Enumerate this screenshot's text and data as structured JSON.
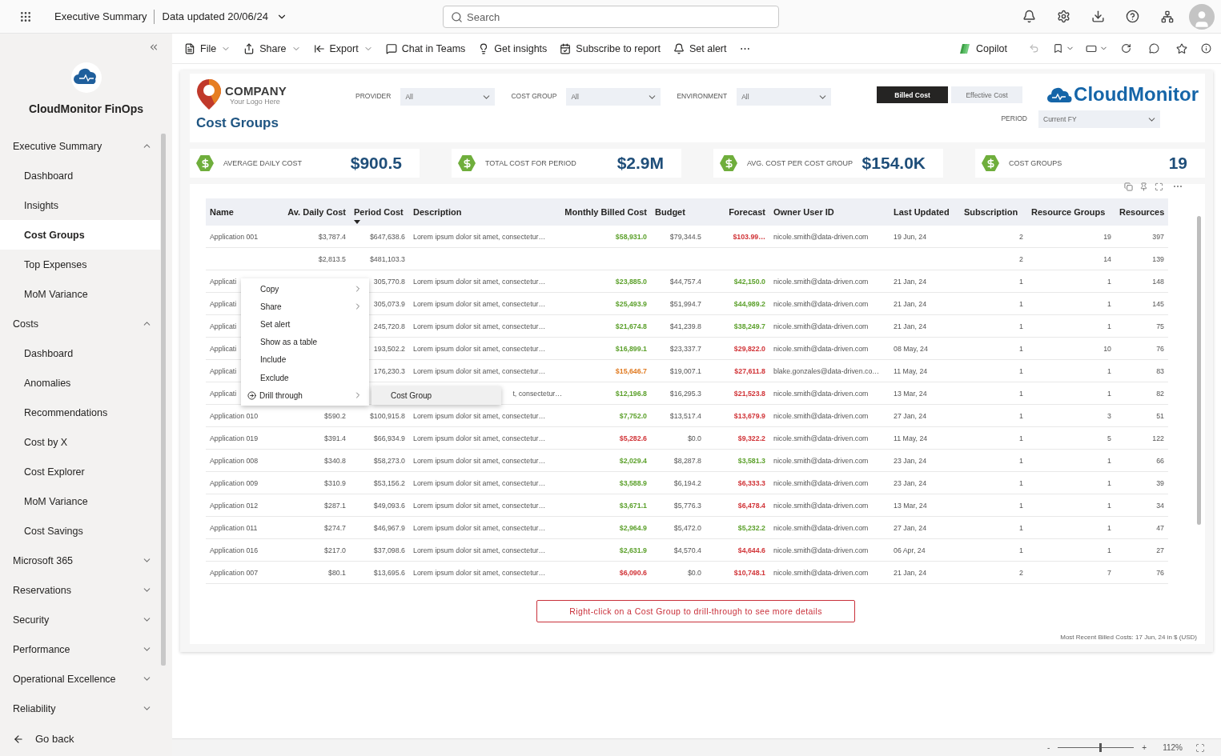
{
  "top_bar": {
    "report": "Executive Summary",
    "updated": "Data updated 20/06/24",
    "search": {
      "placeholder": "Search"
    }
  },
  "sidebar": {
    "app_name": "CloudMonitor FinOps",
    "nav": [
      {
        "label": "Executive Summary",
        "expanded": true,
        "children": [
          {
            "label": "Dashboard",
            "selected": false
          },
          {
            "label": "Insights",
            "selected": false
          },
          {
            "label": "Cost Groups",
            "selected": true
          },
          {
            "label": "Top Expenses",
            "selected": false
          },
          {
            "label": "MoM Variance",
            "selected": false
          }
        ]
      },
      {
        "label": "Costs",
        "expanded": true,
        "children": [
          {
            "label": "Dashboard",
            "selected": false
          },
          {
            "label": "Anomalies",
            "selected": false
          },
          {
            "label": "Recommendations",
            "selected": false
          },
          {
            "label": "Cost by X",
            "selected": false
          },
          {
            "label": "Cost Explorer",
            "selected": false
          },
          {
            "label": "MoM Variance",
            "selected": false
          },
          {
            "label": "Cost Savings",
            "selected": false
          }
        ]
      },
      {
        "label": "Microsoft 365",
        "expanded": false
      },
      {
        "label": "Reservations",
        "expanded": false
      },
      {
        "label": "Security",
        "expanded": false
      },
      {
        "label": "Performance",
        "expanded": false
      },
      {
        "label": "Operational Excellence",
        "expanded": false
      },
      {
        "label": "Reliability",
        "expanded": false
      }
    ],
    "back": "Go back"
  },
  "toolbar": {
    "actions": [
      {
        "label": "File",
        "caret": true
      },
      {
        "label": "Share",
        "caret": true
      },
      {
        "label": "Export",
        "caret": true
      },
      {
        "label": "Chat in Teams",
        "caret": false
      },
      {
        "label": "Get insights",
        "caret": false
      },
      {
        "label": "Subscribe to report",
        "caret": false
      },
      {
        "label": "Set alert",
        "caret": false
      }
    ],
    "more": "⋯",
    "copilot": "Copilot"
  },
  "report": {
    "company": "COMPANY",
    "tagline": "Your Logo Here",
    "title": "Cost Groups",
    "brand": "CloudMonitor",
    "filters": [
      {
        "label": "PROVIDER",
        "value": "All"
      },
      {
        "label": "COST GROUP",
        "value": "All"
      },
      {
        "label": "ENVIRONMENT",
        "value": "All"
      }
    ],
    "cost_toggle": [
      {
        "label": "Billed Cost",
        "selected": true
      },
      {
        "label": "Effective Cost",
        "selected": false
      }
    ],
    "period": {
      "label": "PERIOD",
      "value": "Current FY"
    },
    "kpis": [
      {
        "label": "AVERAGE DAILY COST",
        "value": "$900.5"
      },
      {
        "label": "TOTAL COST FOR PERIOD",
        "value": "$2.9M"
      },
      {
        "label": "AVG. COST PER COST GROUP",
        "value": "$154.0K"
      },
      {
        "label": "COST GROUPS",
        "value": "19"
      }
    ],
    "table": {
      "more": "⋯",
      "columns": [
        {
          "label": "Name",
          "sorted": false
        },
        {
          "label": "Av. Daily Cost",
          "sorted": false
        },
        {
          "label": "Period Cost",
          "sorted": true
        },
        {
          "label": "Description",
          "sorted": false
        },
        {
          "label": "Monthly Billed Cost",
          "sorted": false
        },
        {
          "label": "Budget",
          "sorted": false
        },
        {
          "label": "Forecast",
          "sorted": false
        },
        {
          "label": "Owner User ID",
          "sorted": false
        },
        {
          "label": "Last Updated",
          "sorted": false
        },
        {
          "label": "Subscription",
          "sorted": false
        },
        {
          "label": "Resource Groups",
          "sorted": false
        },
        {
          "label": "Resources",
          "sorted": false
        }
      ],
      "rows": [
        {
          "name": "Application 001",
          "avg_daily": "$3,787.4",
          "period": "$647,638.6",
          "description": "Lorem ipsum dolor sit amet, consectetur…",
          "monthly": {
            "text": "$58,931.0",
            "color": "#5da12d"
          },
          "budget": "$79,344.5",
          "forecast": {
            "text": "$103.99…",
            "color": "#d13438"
          },
          "owner": "nicole.smith@data-driven.com",
          "updated": "19 Jun, 24",
          "subscription": "2",
          "resource_groups": "19",
          "resources": "397"
        },
        {
          "avg_daily": "$2,813.5",
          "period": "$481,103.3",
          "subscription": "2",
          "resource_groups": "14",
          "resources": "139"
        },
        {
          "name": "Applicati",
          "period": "305,770.8",
          "description": "Lorem ipsum dolor sit amet, consectetur…",
          "monthly": {
            "text": "$23,885.0",
            "color": "#5da12d"
          },
          "budget": "$44,757.4",
          "forecast": {
            "text": "$42,150.0",
            "color": "#5da12d"
          },
          "owner": "nicole.smith@data-driven.com",
          "updated": "21 Jan, 24",
          "subscription": "1",
          "resource_groups": "1",
          "resources": "148"
        },
        {
          "name": "Applicati",
          "period": "305,073.9",
          "description": "Lorem ipsum dolor sit amet, consectetur…",
          "monthly": {
            "text": "$25,493.9",
            "color": "#5da12d"
          },
          "budget": "$51,994.7",
          "forecast": {
            "text": "$44,989.2",
            "color": "#5da12d"
          },
          "owner": "nicole.smith@data-driven.com",
          "updated": "21 Jan, 24",
          "subscription": "1",
          "resource_groups": "1",
          "resources": "145"
        },
        {
          "name": "Applicati",
          "period": "245,720.8",
          "description": "Lorem ipsum dolor sit amet, consectetur…",
          "monthly": {
            "text": "$21,674.8",
            "color": "#5da12d"
          },
          "budget": "$41,239.8",
          "forecast": {
            "text": "$38,249.7",
            "color": "#5da12d"
          },
          "owner": "nicole.smith@data-driven.com",
          "updated": "21 Jan, 24",
          "subscription": "1",
          "resource_groups": "1",
          "resources": "75"
        },
        {
          "name": "Applicati",
          "period": "193,502.2",
          "description": "Lorem ipsum dolor sit amet, consectetur…",
          "monthly": {
            "text": "$16,899.1",
            "color": "#5da12d"
          },
          "budget": "$23,337.7",
          "forecast": {
            "text": "$29,822.0",
            "color": "#d13438"
          },
          "owner": "nicole.smith@data-driven.com",
          "updated": "08 May, 24",
          "subscription": "1",
          "resource_groups": "10",
          "resources": "76"
        },
        {
          "name": "Applicati",
          "period": "176,230.3",
          "description": "Lorem ipsum dolor sit amet, consectetur…",
          "monthly": {
            "text": "$15,646.7",
            "color": "#e07b22"
          },
          "budget": "$19,007.1",
          "forecast": {
            "text": "$27,611.8",
            "color": "#d13438"
          },
          "owner": "blake.gonzales@data-driven.co…",
          "updated": "11 May, 24",
          "subscription": "1",
          "resource_groups": "1",
          "resources": "83"
        },
        {
          "name": "Applicati",
          "description": "t, consectetur…",
          "description_cut": true,
          "monthly": {
            "text": "$12,196.8",
            "color": "#5da12d"
          },
          "budget": "$16,295.3",
          "forecast": {
            "text": "$21,523.8",
            "color": "#d13438"
          },
          "owner": "nicole.smith@data-driven.com",
          "updated": "13 Mar, 24",
          "subscription": "1",
          "resource_groups": "1",
          "resources": "82"
        },
        {
          "name": "Application 010",
          "avg_daily": "$590.2",
          "period": "$100,915.8",
          "description": "Lorem ipsum dolor sit amet, consectetur…",
          "monthly": {
            "text": "$7,752.0",
            "color": "#5da12d"
          },
          "budget": "$13,517.4",
          "forecast": {
            "text": "$13,679.9",
            "color": "#d13438"
          },
          "owner": "nicole.smith@data-driven.com",
          "updated": "27 Jan, 24",
          "subscription": "1",
          "resource_groups": "3",
          "resources": "51"
        },
        {
          "name": "Application 019",
          "avg_daily": "$391.4",
          "period": "$66,934.9",
          "description": "Lorem ipsum dolor sit amet, consectetur…",
          "monthly": {
            "text": "$5,282.6",
            "color": "#d13438"
          },
          "budget": "$0.0",
          "forecast": {
            "text": "$9,322.2",
            "color": "#d13438"
          },
          "owner": "nicole.smith@data-driven.com",
          "updated": "11 May, 24",
          "subscription": "1",
          "resource_groups": "5",
          "resources": "122"
        },
        {
          "name": "Application 008",
          "avg_daily": "$340.8",
          "period": "$58,273.0",
          "description": "Lorem ipsum dolor sit amet, consectetur…",
          "monthly": {
            "text": "$2,029.4",
            "color": "#5da12d"
          },
          "budget": "$8,287.8",
          "forecast": {
            "text": "$3,581.3",
            "color": "#5da12d"
          },
          "owner": "nicole.smith@data-driven.com",
          "updated": "23 Jan, 24",
          "subscription": "1",
          "resource_groups": "1",
          "resources": "66"
        },
        {
          "name": "Application 009",
          "avg_daily": "$310.9",
          "period": "$53,156.2",
          "description": "Lorem ipsum dolor sit amet, consectetur…",
          "monthly": {
            "text": "$3,588.9",
            "color": "#5da12d"
          },
          "budget": "$6,194.2",
          "forecast": {
            "text": "$6,333.3",
            "color": "#d13438"
          },
          "owner": "nicole.smith@data-driven.com",
          "updated": "23 Jan, 24",
          "subscription": "1",
          "resource_groups": "1",
          "resources": "39"
        },
        {
          "name": "Application 012",
          "avg_daily": "$287.1",
          "period": "$49,093.6",
          "description": "Lorem ipsum dolor sit amet, consectetur…",
          "monthly": {
            "text": "$3,671.1",
            "color": "#5da12d"
          },
          "budget": "$5,776.3",
          "forecast": {
            "text": "$6,478.4",
            "color": "#d13438"
          },
          "owner": "nicole.smith@data-driven.com",
          "updated": "13 Mar, 24",
          "subscription": "1",
          "resource_groups": "1",
          "resources": "34"
        },
        {
          "name": "Application 011",
          "avg_daily": "$274.7",
          "period": "$46,967.9",
          "description": "Lorem ipsum dolor sit amet, consectetur…",
          "monthly": {
            "text": "$2,964.9",
            "color": "#5da12d"
          },
          "budget": "$5,472.0",
          "forecast": {
            "text": "$5,232.2",
            "color": "#5da12d"
          },
          "owner": "nicole.smith@data-driven.com",
          "updated": "27 Jan, 24",
          "subscription": "1",
          "resource_groups": "1",
          "resources": "47"
        },
        {
          "name": "Application 016",
          "avg_daily": "$217.0",
          "period": "$37,098.6",
          "description": "Lorem ipsum dolor sit amet, consectetur…",
          "monthly": {
            "text": "$2,631.9",
            "color": "#5da12d"
          },
          "budget": "$4,570.4",
          "forecast": {
            "text": "$4,644.6",
            "color": "#d13438"
          },
          "owner": "nicole.smith@data-driven.com",
          "updated": "06 Apr, 24",
          "subscription": "1",
          "resource_groups": "1",
          "resources": "27"
        },
        {
          "name": "Application 007",
          "avg_daily": "$80.1",
          "period": "$13,695.6",
          "description": "Lorem ipsum dolor sit amet, consectetur…",
          "monthly": {
            "text": "$6,090.6",
            "color": "#d13438"
          },
          "budget": "$0.0",
          "forecast": {
            "text": "$10,748.1",
            "color": "#d13438"
          },
          "owner": "nicole.smith@data-driven.com",
          "updated": "21 Jan, 24",
          "subscription": "2",
          "resource_groups": "7",
          "resources": "76"
        }
      ]
    },
    "context_menu": {
      "items": [
        {
          "label": "Copy",
          "kind": "submenu"
        },
        {
          "label": "Share",
          "kind": "submenu"
        },
        {
          "label": "Set alert",
          "kind": "action"
        },
        {
          "label": "Show as a table",
          "kind": "action"
        },
        {
          "label": "Include",
          "kind": "action"
        },
        {
          "label": "Exclude",
          "kind": "action"
        },
        {
          "label": "Drill through",
          "kind": "drill"
        }
      ],
      "submenu": [
        {
          "label": "Cost Group",
          "selected": true
        }
      ]
    },
    "hint": "Right-click on a Cost Group to drill-through to see more details",
    "footnote": "Most Recent Billed Costs: 17 Jun, 24 in $ (USD)"
  },
  "status_bar": {
    "zoom_out": "-",
    "zoom_in": "+",
    "zoom": {
      "level": 0.55
    },
    "zoom_value": "112%"
  }
}
